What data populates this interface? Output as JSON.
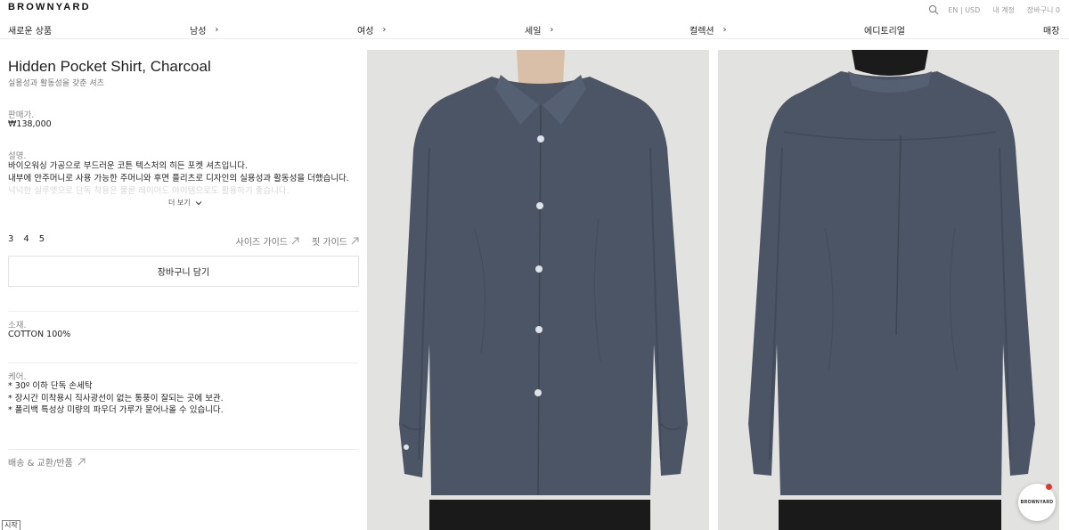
{
  "header": {
    "logo": "BROWNYARD",
    "lang": "EN | USD",
    "account": "내 계정",
    "cart": "장바구니 0"
  },
  "nav": {
    "new": "새로운 상품",
    "men": "남성",
    "women": "여성",
    "sale": "세일",
    "collection": "컬렉션",
    "editorial": "에디토리얼",
    "store": "매장"
  },
  "product": {
    "title": "Hidden Pocket Shirt, Charcoal",
    "subtitle": "실용성과 활동성을 갖춘 셔츠",
    "price_label": "판매가.",
    "price": "₩138,000",
    "desc_label": "설명.",
    "desc_line1": "바이오워싱 가공으로 부드러운 코튼 텍스처의 히든 포켓 셔츠입니다.",
    "desc_line2": "내부에 안주머니로 사용 가능한 주머니와 후면 플리츠로 디자인의 실용성과 활동성을 더했습니다.",
    "desc_line3": "넉넉한 실루엣으로 단독 착용은 물론 레이어드 아이템으로도 활용하기 좋습니다.",
    "more": "더 보기",
    "sizes": [
      "3",
      "4",
      "5"
    ],
    "size_guide": "사이즈 가이드",
    "fit_guide": "핏 가이드",
    "add_to_cart": "장바구니 담기",
    "material_label": "소재.",
    "material": "COTTON 100%",
    "care_label": "케어.",
    "care": [
      "* 30º 이하 단독 손세탁",
      "* 장시간 미착용시 직사광선이 없는 통풍이 잘되는 곳에 보관.",
      "* 폴리백 특성상 미량의 파우더 가루가 묻어나올 수 있습니다."
    ],
    "shipping": "배송 & 교환/반품"
  },
  "badge": {
    "text": "BROWNYARD"
  },
  "taskbar": {
    "start": "시작"
  },
  "colors": {
    "shirt": "#4b5565",
    "background": "#e2e2e0",
    "badge_dot": "#e2382f"
  },
  "icons": [
    "search-icon",
    "chevron-right-icon",
    "chevron-down-icon",
    "arrow-up-right-icon"
  ]
}
